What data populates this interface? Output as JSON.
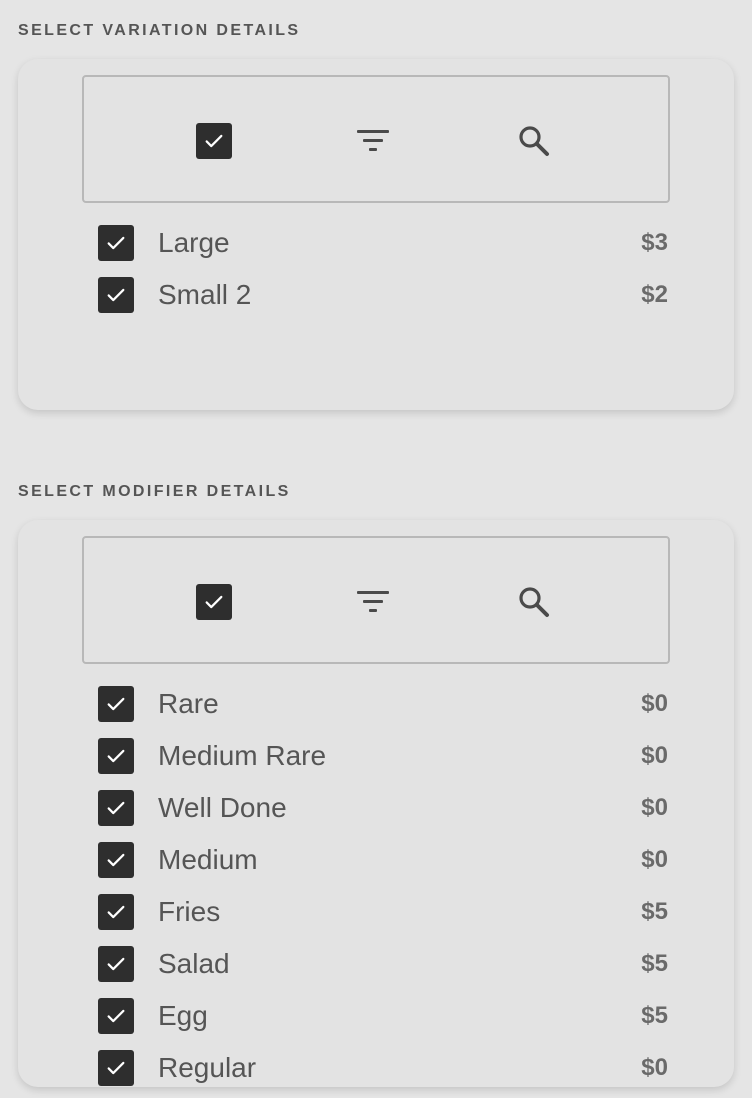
{
  "variation": {
    "title": "SELECT VARIATION DETAILS",
    "toolbar": {
      "select_all_icon": "checkbox-checked-icon",
      "filter_icon": "filter-icon",
      "search_icon": "search-icon"
    },
    "items": [
      {
        "label": "Large",
        "price": "$3",
        "checked": true
      },
      {
        "label": "Small 2",
        "price": "$2",
        "checked": true
      }
    ]
  },
  "modifier": {
    "title": "SELECT MODIFIER DETAILS",
    "toolbar": {
      "select_all_icon": "checkbox-checked-icon",
      "filter_icon": "filter-icon",
      "search_icon": "search-icon"
    },
    "items": [
      {
        "label": "Rare",
        "price": "$0",
        "checked": true
      },
      {
        "label": "Medium Rare",
        "price": "$0",
        "checked": true
      },
      {
        "label": "Well Done",
        "price": "$0",
        "checked": true
      },
      {
        "label": "Medium",
        "price": "$0",
        "checked": true
      },
      {
        "label": "Fries",
        "price": "$5",
        "checked": true
      },
      {
        "label": "Salad",
        "price": "$5",
        "checked": true
      },
      {
        "label": "Egg",
        "price": "$5",
        "checked": true
      },
      {
        "label": "Regular",
        "price": "$0",
        "checked": true
      }
    ]
  },
  "colors": {
    "background": "#e5e5e5",
    "checkbox": "#2e2e2e",
    "text": "#555555"
  }
}
